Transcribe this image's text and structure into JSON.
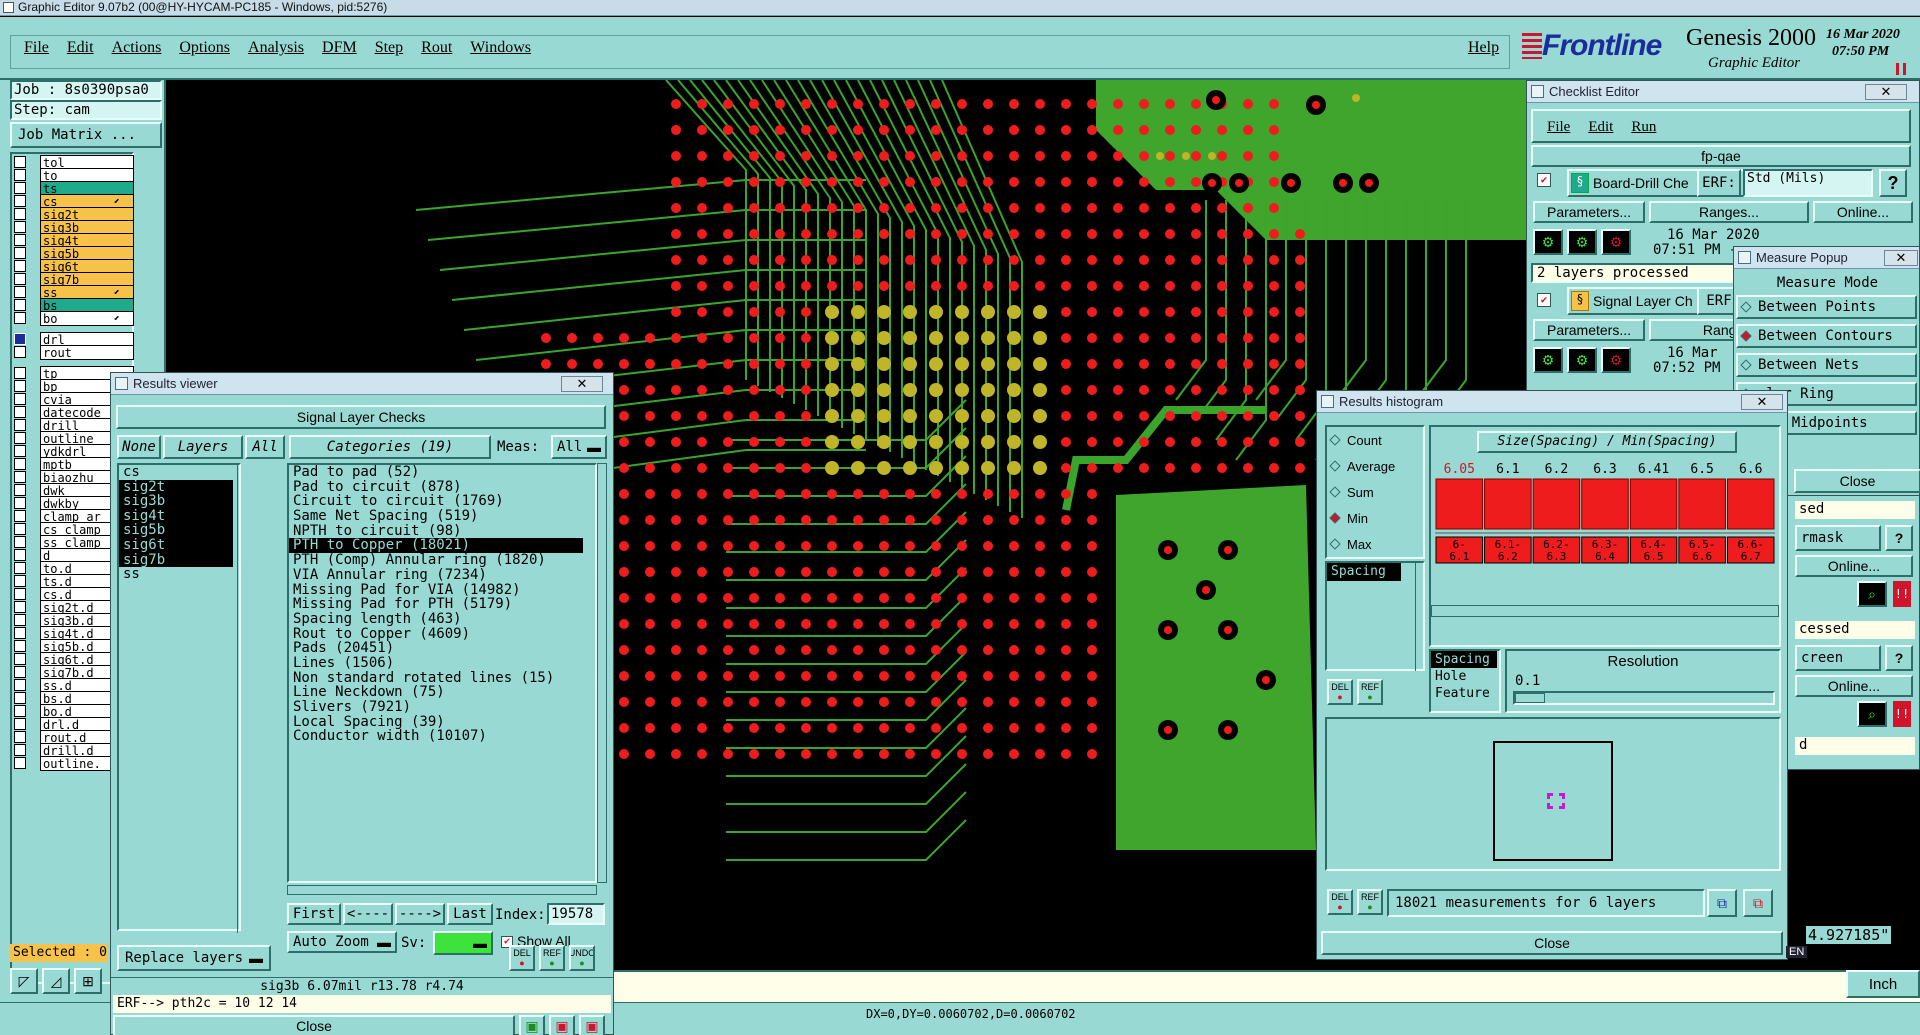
{
  "window_title": "Graphic Editor 9.07b2 (00@HY-HYCAM-PC185 - Windows, pid:5276)",
  "menu": [
    "File",
    "Edit",
    "Actions",
    "Options",
    "Analysis",
    "DFM",
    "Step",
    "Rout",
    "Windows"
  ],
  "help_label": "Help",
  "brand": {
    "logo": "Frontline",
    "product": "Genesis 2000",
    "subtitle": "Graphic Editor",
    "date": "16 Mar 2020",
    "time": "07:50 PM"
  },
  "job": {
    "job_label": "Job : 8s0390psa0",
    "step_label": "Step: cam",
    "matrix_button": "Job Matrix ..."
  },
  "layers_top": [
    {
      "name": "tol",
      "color": "#ffffff"
    },
    {
      "name": "to",
      "color": "#ffffff"
    },
    {
      "name": "ts",
      "color": "#1faa8c"
    },
    {
      "name": "cs",
      "color": "#f7c24a",
      "mark": "⬋"
    },
    {
      "name": "sig2t",
      "color": "#f7c24a"
    },
    {
      "name": "sig3b",
      "color": "#f7c24a"
    },
    {
      "name": "sig4t",
      "color": "#f7c24a"
    },
    {
      "name": "sig5b",
      "color": "#f7c24a"
    },
    {
      "name": "sig6t",
      "color": "#f7c24a"
    },
    {
      "name": "sig7b",
      "color": "#f7c24a"
    },
    {
      "name": "ss",
      "color": "#f7c24a",
      "mark": "⬋"
    },
    {
      "name": "bs",
      "color": "#1faa8c"
    },
    {
      "name": "bo",
      "color": "#ffffff",
      "mark": "⬋"
    }
  ],
  "layers_drill": [
    {
      "name": "drl",
      "color": "#ffffff"
    },
    {
      "name": "rout",
      "color": "#ffffff"
    }
  ],
  "layers_misc": [
    "tp",
    "bp",
    "cvia",
    "datecode",
    "drill",
    "outline",
    "ydkdrl",
    "mptb",
    "biaozhu",
    "dwk",
    "dwkby",
    "clamp_ar",
    "cs_clamp",
    "ss_clamp",
    "d",
    "to.d",
    "ts.d",
    "cs.d",
    "sig2t.d",
    "sig3b.d",
    "sig4t.d",
    "sig5b.d",
    "sig6t.d",
    "sig7b.d",
    "ss.d",
    "bs.d",
    "bo.d",
    "drl.d",
    "rout.d",
    "drill.d",
    "outline."
  ],
  "selected_label": "Selected : 0",
  "results_viewer": {
    "title": "Results viewer",
    "heading": "Signal Layer Checks",
    "none_btn": "None",
    "layers_btn": "Layers",
    "all_btn": "All",
    "categories_btn": "Categories (19)",
    "meas_label": "Meas:",
    "meas_value": "All",
    "layers": [
      "cs",
      "sig2t",
      "sig3b",
      "sig4t",
      "sig5b",
      "sig6t",
      "sig7b",
      "ss"
    ],
    "categories": [
      "Pad to pad (52)",
      "Pad to circuit (878)",
      "Circuit to circuit (1769)",
      "Same Net Spacing (519)",
      "NPTH to circuit (98)",
      "PTH to Copper (18021)",
      "PTH (Comp) Annular ring (1820)",
      "VIA Annular ring (7234)",
      "Missing Pad for VIA (14982)",
      "Missing Pad for PTH (5179)",
      "Spacing length (463)",
      "Rout to Copper (4609)",
      "Pads (20451)",
      "Lines (1506)",
      "Non standard rotated lines (15)",
      "Line Neckdown (75)",
      "Slivers (7921)",
      "Local Spacing (39)",
      "Conductor width (10107)"
    ],
    "first": "First",
    "prev": "<----",
    "next": "---->",
    "last": "Last",
    "index_label": "Index:",
    "index_value": "19578",
    "auto_zoom": "Auto Zoom",
    "sv_label": "Sv:",
    "show_all": "Show All",
    "replace_layers": "Replace layers",
    "del": "DEL",
    "ref": "REF",
    "undo": "UNDO",
    "status": "sig3b 6.07mil  r13.78  r4.74",
    "erf": "ERF--> pth2c = 10 12 14",
    "close": "Close"
  },
  "checklist": {
    "title": "Checklist Editor",
    "menu": [
      "File",
      "Edit",
      "Run"
    ],
    "name": "fp-qae",
    "item1": {
      "name": "Board-Drill Che",
      "erf": "ERF:",
      "erf_value": "Std (Mils)",
      "params": "Parameters...",
      "ranges": "Ranges...",
      "online": "Online...",
      "date": "16 Mar 2020",
      "time": "07:51 PM -",
      "status": "2 layers processed"
    },
    "item2": {
      "name": "Signal Layer Ch",
      "erf": "ERF",
      "params": "Parameters...",
      "ranges": "Ranges.",
      "date": "16 Mar",
      "time": "07:52 PM"
    },
    "side_frags": [
      "sed",
      "rmask",
      "Online...",
      "cessed",
      "creen",
      "Online...",
      "d"
    ]
  },
  "measure": {
    "title": "Measure Popup",
    "mode_label": "Measure Mode",
    "modes": [
      "Between Points",
      "Between Contours",
      "Between Nets",
      "ular Ring",
      "een Midpoints"
    ],
    "selected": 1,
    "close": "Close"
  },
  "histogram": {
    "title": "Results histogram",
    "stats": [
      "Count",
      "Average",
      "Sum",
      "Min",
      "Max"
    ],
    "selected_stat": 3,
    "list": [
      "Spacing"
    ],
    "chart_title": "Size(Spacing) / Min(Spacing)",
    "bin_values": [
      "6.05",
      "6.1",
      "6.2",
      "6.3",
      "6.41",
      "6.5",
      "6.6"
    ],
    "bin_labels": [
      [
        "6-",
        "6.1"
      ],
      [
        "6.1-",
        "6.2"
      ],
      [
        "6.2-",
        "6.3"
      ],
      [
        "6.3-",
        "6.4"
      ],
      [
        "6.4-",
        "6.5"
      ],
      [
        "6.5-",
        "6.6"
      ],
      [
        "6.6-",
        "6.7"
      ]
    ],
    "types": [
      "Spacing",
      "Hole",
      "Feature"
    ],
    "resolution_label": "Resolution",
    "resolution_value": "0.1",
    "del": "DEL",
    "ref": "REF",
    "summary": "18021 measurements for 6 layers",
    "close": "Close"
  },
  "coords": {
    "readout": "DX=0,DY=0.0060702,D=0.0060702",
    "y_value": "4.927185\"",
    "unit": "Inch",
    "ime": "EN"
  },
  "colors": {
    "ui": "#99d9d4",
    "pad_red": "#ee1c1c",
    "trace_green": "#3aa52b",
    "pad_yellow": "#c0b428",
    "copper_pour": "#3fa52c"
  }
}
